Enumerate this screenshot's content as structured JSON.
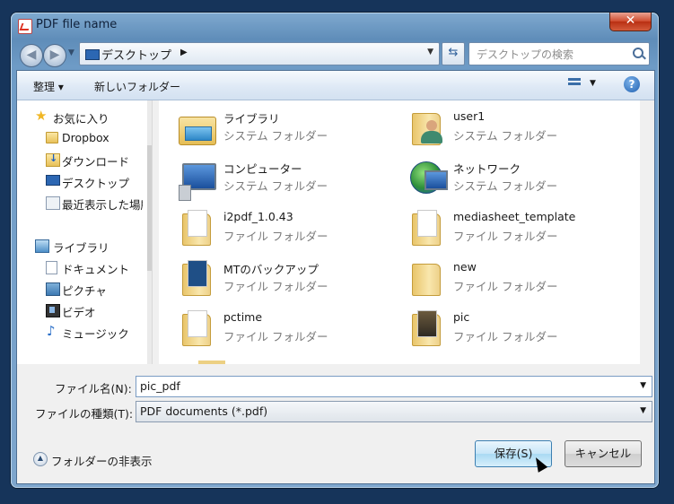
{
  "window": {
    "title": "PDF file name",
    "close_label": "✕"
  },
  "address": {
    "current": "デスクトップ",
    "search_placeholder": "デスクトップの検索"
  },
  "toolbar": {
    "organize": "整理 ▾",
    "new_folder": "新しいフォルダー",
    "help": "?"
  },
  "nav": {
    "favorites": "お気に入り",
    "items1": [
      "Dropbox",
      "ダウンロード",
      "デスクトップ",
      "最近表示した場所"
    ],
    "libraries": "ライブラリ",
    "items2": [
      "ドキュメント",
      "ピクチャ",
      "ビデオ",
      "ミュージック"
    ]
  },
  "files": [
    {
      "name": "ライブラリ",
      "type": "システム フォルダー",
      "icon": "library-icon"
    },
    {
      "name": "user1",
      "type": "システム フォルダー",
      "icon": "user-folder-icon"
    },
    {
      "name": "コンピューター",
      "type": "システム フォルダー",
      "icon": "computer-icon"
    },
    {
      "name": "ネットワーク",
      "type": "システム フォルダー",
      "icon": "network-icon"
    },
    {
      "name": "i2pdf_1.0.43",
      "type": "ファイル フォルダー",
      "icon": "folder-icon"
    },
    {
      "name": "mediasheet_template",
      "type": "ファイル フォルダー",
      "icon": "folder-icon"
    },
    {
      "name": "MTのバックアップ",
      "type": "ファイル フォルダー",
      "icon": "folder-icon"
    },
    {
      "name": "new",
      "type": "ファイル フォルダー",
      "icon": "folder-icon"
    },
    {
      "name": "pctime",
      "type": "ファイル フォルダー",
      "icon": "folder-icon"
    },
    {
      "name": "pic",
      "type": "ファイル フォルダー",
      "icon": "folder-icon"
    }
  ],
  "form": {
    "filename_label": "ファイル名(N):",
    "filename_value": "pic_pdf",
    "filetype_label": "ファイルの種類(T):",
    "filetype_value": "PDF documents (*.pdf)",
    "hide_folders": "フォルダーの非表示",
    "save": "保存(S)",
    "cancel": "キャンセル"
  },
  "colors": {
    "accent": "#3c7fb1",
    "frame": "#6e9bc6"
  }
}
